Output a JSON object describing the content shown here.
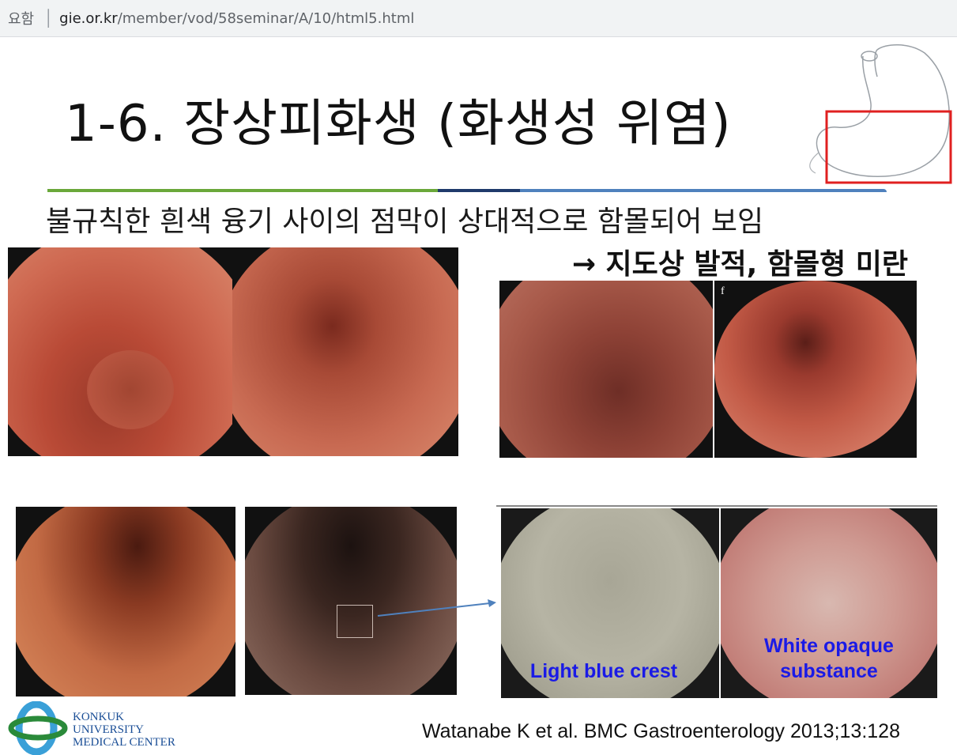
{
  "browser": {
    "security_label": "요함",
    "url_host": "gie.or.kr",
    "url_path": "/member/vod/58seminar/A/10/html5.html"
  },
  "slide": {
    "title": "1-6. 장상피화생 (화생성 위염)",
    "subtitle_line1": "불규칙한 흰색 융기 사이의 점막이 상대적으로 함몰되어 보임",
    "subtitle_line2": "→ 지도상 발적, 함몰형 미란",
    "nbi_label_left": "Light blue crest",
    "nbi_label_right_1": "White opaque",
    "nbi_label_right_2": "substance",
    "citation": "Watanabe K et al. BMC Gastroenterology 2013;13:128",
    "logo_line1": "KONKUK",
    "logo_line2": "UNIVERSITY",
    "logo_line3": "MEDICAL CENTER",
    "panel_letter_f": "f"
  },
  "colors": {
    "accent_green": "#6aa83a",
    "accent_navy": "#1f3a6b",
    "accent_blue": "#4f81bd",
    "highlight_red": "#e02020",
    "nbi_text": "#1a1ae6"
  }
}
